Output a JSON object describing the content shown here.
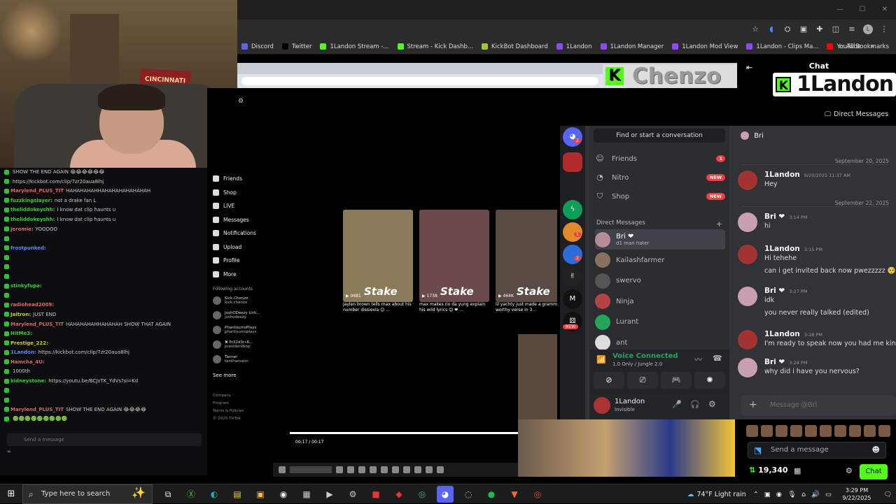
{
  "window": {
    "min": "—",
    "max": "☐",
    "close": "✕"
  },
  "bookmarks": [
    {
      "label": "Discord",
      "icon": "discord-icon",
      "color": "#5865f2"
    },
    {
      "label": "Twitter",
      "icon": "x-icon",
      "color": "#000000"
    },
    {
      "label": "1Landon Stream -...",
      "icon": "kick-icon",
      "color": "#53fc18"
    },
    {
      "label": "Stream - Kick Dashb...",
      "icon": "kick-icon",
      "color": "#53fc18"
    },
    {
      "label": "KickBot Dashboard",
      "icon": "kickbot-icon",
      "color": "#9acd32"
    },
    {
      "label": "1Landon",
      "icon": "twitch-icon",
      "color": "#9146ff"
    },
    {
      "label": "1Landon Manager",
      "icon": "twitch-icon",
      "color": "#9146ff"
    },
    {
      "label": "1Landon Mod View",
      "icon": "twitch-icon",
      "color": "#9146ff"
    },
    {
      "label": "1Landon - Clips Ma...",
      "icon": "twitch-icon",
      "color": "#9146ff"
    },
    {
      "label": "YouTube",
      "icon": "youtube-icon",
      "color": "#ff0000"
    }
  ],
  "bookmarks_overflow": "»",
  "all_bookmarks": "All Bookmarks",
  "overlay": {
    "chenzo": "Chenzo",
    "chat_header": "Chat",
    "logo": "1Landon"
  },
  "stream_chat": {
    "lines": [
      {
        "user": "",
        "text": "SHOW THE END AGAIN 😂😂😂😂😂😂",
        "color": "red"
      },
      {
        "user": "",
        "text": "https://kickbot.com/clip/7zr20aua8lhj",
        "color": "blue"
      },
      {
        "user": "Marylend_PLUS_TIT",
        "text": "HAHAHAHAHHAHAHAHAHAHAHAH",
        "color": "red"
      },
      {
        "user": "fuzzkingslayer:",
        "text": "not a drake fan L",
        "color": "green"
      },
      {
        "user": "theliddokeyshh:",
        "text": "I know dat clip haunts u",
        "color": "green"
      },
      {
        "user": "theliddokeyshh:",
        "text": "I know dat clip haunts u",
        "color": "green"
      },
      {
        "user": "jeremie:",
        "text": "YOOOOO",
        "color": "red"
      },
      {
        "user": "",
        "text": "",
        "color": "red"
      },
      {
        "user": "frostpunked:",
        "text": "",
        "color": "blue"
      },
      {
        "user": "",
        "text": "",
        "color": "red"
      },
      {
        "user": "",
        "text": "",
        "color": "red"
      },
      {
        "user": "",
        "text": "",
        "color": "red"
      },
      {
        "user": "stinkyfupa:",
        "text": "",
        "color": "green"
      },
      {
        "user": "",
        "text": "",
        "color": "red"
      },
      {
        "user": "radiohead2009:",
        "text": "",
        "color": "red"
      },
      {
        "user": "Jaitron:",
        "text": "JUST END",
        "color": "yel"
      },
      {
        "user": "Marylend_PLUS_TIT",
        "text": "HAHAHAHAHHAHAHAH SHOW THAT AGAIN",
        "color": "red"
      },
      {
        "user": "HitMe3:",
        "text": "",
        "color": "green"
      },
      {
        "user": "Prestige_222:",
        "text": "",
        "color": "yel"
      },
      {
        "user": "1Landon:",
        "text": "https://kickbot.com/clip/7zr20aua8lhj",
        "color": "blue"
      },
      {
        "user": "Hamcha_4U:",
        "text": "",
        "color": "red"
      },
      {
        "user": "",
        "text": "1000th",
        "color": "blue"
      },
      {
        "user": "kidneystone:",
        "text": "https://youtu.be/BCJvTK_YdVs?si=Kd",
        "color": "green"
      },
      {
        "user": "",
        "text": "",
        "color": "red"
      },
      {
        "user": "",
        "text": "",
        "color": "red"
      },
      {
        "user": "Marylend_PLUS_TIT",
        "text": "SHOW THE END AGAIN 😂😂😂😂",
        "color": "red"
      },
      {
        "user": "",
        "text": "🟢🟢🟢🟢🟢🟢🟢🟢🟢",
        "color": "green"
      }
    ],
    "input_placeholder": "Send a message",
    "footer": "∞"
  },
  "tiktok": {
    "nav": [
      "Friends",
      "Shop",
      "LIVE",
      "Messages",
      "Notifications",
      "Upload",
      "Profile",
      "More"
    ],
    "section_following": "Following accounts",
    "accounts": [
      {
        "name": "Kick.Chenzo",
        "handle": "kick.chenzo"
      },
      {
        "name": "JoshODeezy Unli...",
        "handle": "joshodeezy"
      },
      {
        "name": "PhantoumsPlays",
        "handle": "phantoumsplays"
      },
      {
        "name": "✖ Pr32d3r•8...",
        "handle": "presidentbop"
      },
      {
        "name": "Tanner",
        "handle": "tanthamann"
      }
    ],
    "see_more": "See more",
    "footer": [
      "Company",
      "Program",
      "Terms & Policies",
      "© 2025 TikTok"
    ],
    "videos": [
      {
        "caption": "jaylen brown tells max about his number dissiexia 😊 ...",
        "views": "9481",
        "brand": "Stake"
      },
      {
        "caption": "max makes rio da yung explain his wild lyrics 😊 ❤ ...",
        "views": "1738",
        "brand": "Stake"
      },
      {
        "caption": "lil yachty just made a grammy worthy verse in 3...",
        "views": "464K",
        "brand": "Stake"
      }
    ],
    "time": "00:17 / 00:17"
  },
  "discord": {
    "find": "Find or start a conversation",
    "nav": [
      {
        "label": "Friends",
        "icon": "friends-icon",
        "badge": "1"
      },
      {
        "label": "Nitro",
        "icon": "nitro-icon",
        "badge": "NEW"
      },
      {
        "label": "Shop",
        "icon": "shop-icon",
        "badge": "NEW"
      }
    ],
    "dm_header": "Direct Messages",
    "dm_add": "+",
    "dms": [
      {
        "name": "Bri ❤",
        "sub": "d1 man hater",
        "color": "#b88a9a",
        "active": true
      },
      {
        "name": "Kailashfarmer",
        "sub": "",
        "color": "#8a7060",
        "active": false
      },
      {
        "name": "swervo",
        "sub": "",
        "color": "#555555",
        "active": false
      },
      {
        "name": "Ninja",
        "sub": "",
        "color": "#b44444",
        "active": false
      },
      {
        "name": "Lurant",
        "sub": "",
        "color": "#23a55a",
        "active": false
      },
      {
        "name": "ant",
        "sub": "",
        "color": "#dddddd",
        "active": false
      }
    ],
    "server_badges": [
      "2",
      "1",
      "1"
    ],
    "server_new": "NEW",
    "voice": {
      "status": "Voice Connected",
      "channel": "1.0 Only / Jungle 2.0"
    },
    "user": {
      "name": "1Landon",
      "status": "Invisible"
    },
    "chat_header": {
      "title": "Direct Messages",
      "name": "Bri"
    },
    "dates": [
      "September 20, 2025",
      "September 22, 2025"
    ],
    "messages": [
      {
        "name": "1Landon",
        "time": "9/20/2025 11:37 AM",
        "lines": [
          "Hey"
        ],
        "avatar": "#a33333"
      },
      {
        "name": "Bri ❤",
        "time": "3:14 PM",
        "lines": [
          "hi"
        ],
        "avatar": "#c9a0b0"
      },
      {
        "name": "1Landon",
        "time": "3:15 PM",
        "lines": [
          "Hi tehehe",
          "can i get invited back now pwezzzzz 🥺"
        ],
        "avatar": "#a33333"
      },
      {
        "name": "Bri ❤",
        "time": "3:27 PM",
        "lines": [
          "idk",
          "you never really talked (edited)"
        ],
        "avatar": "#c9a0b0"
      },
      {
        "name": "1Landon",
        "time": "3:28 PM",
        "lines": [
          "I'm ready to speak now you had me kinda n"
        ],
        "avatar": "#a33333"
      },
      {
        "name": "Bri ❤",
        "time": "3:28 PM",
        "lines": [
          "why did i have you nervous?"
        ],
        "avatar": "#c9a0b0"
      }
    ],
    "input_placeholder": "Message @Bri"
  },
  "kick_panel": {
    "send_placeholder": "Send a message",
    "viewers": "19,340",
    "chat_button": "Chat"
  },
  "taskbar": {
    "search_placeholder": "Type here to search",
    "weather": "74°F  Light rain",
    "time": "3:29 PM",
    "date": "9/22/2025"
  }
}
